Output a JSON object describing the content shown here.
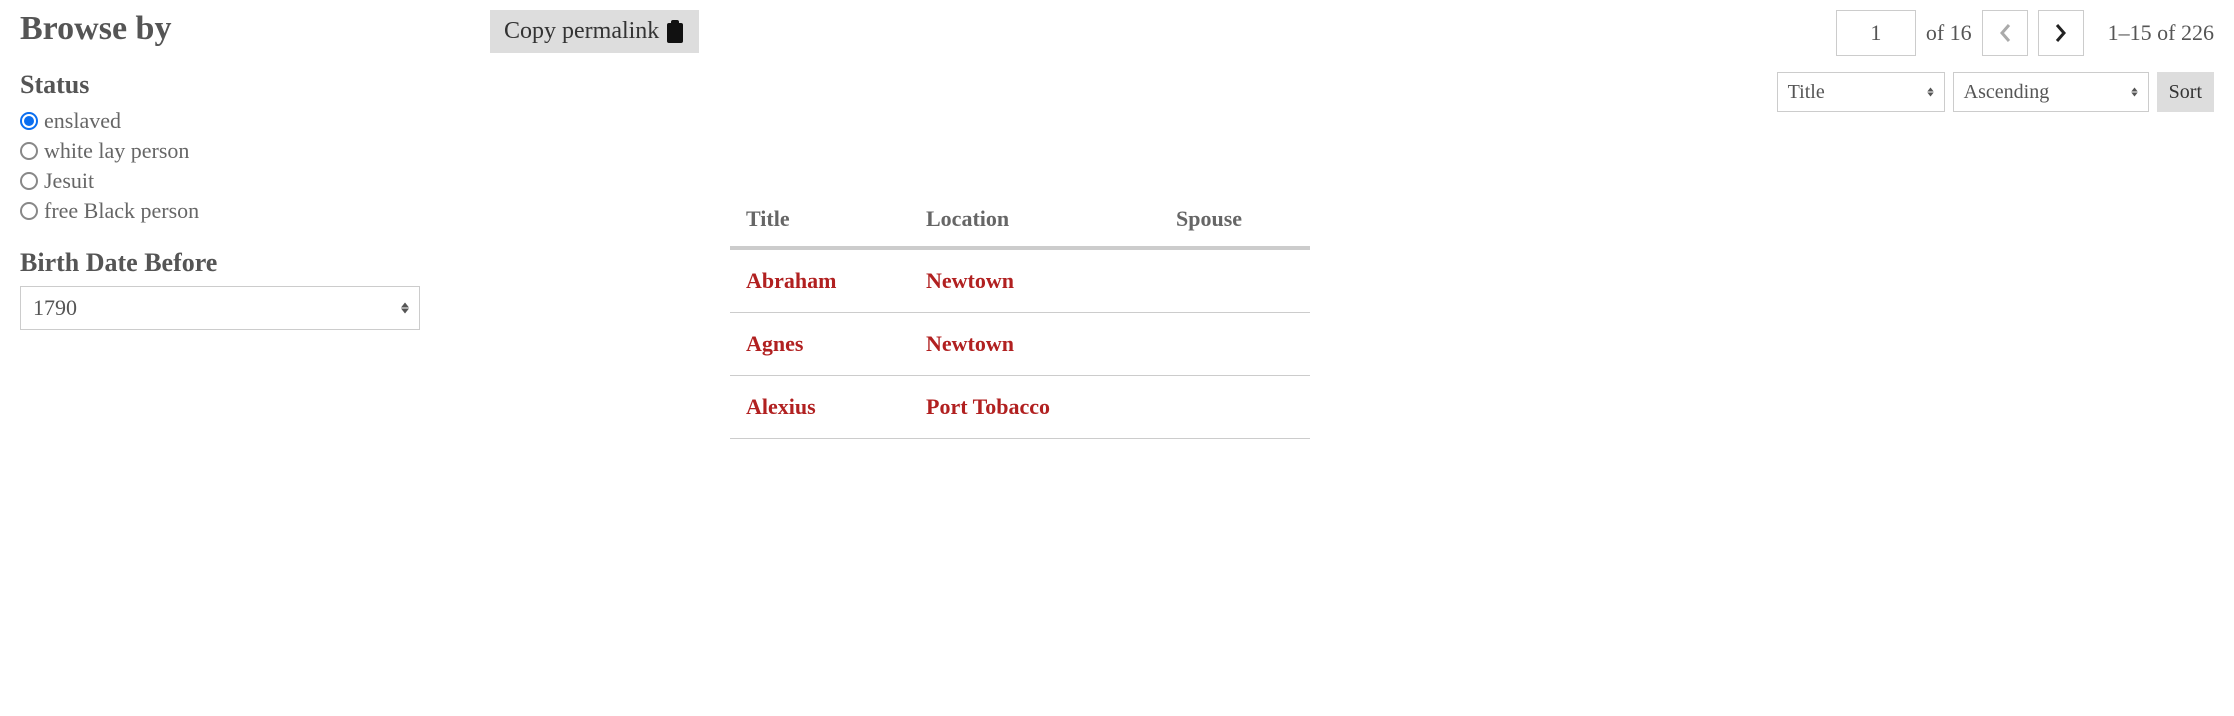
{
  "sidebar": {
    "heading": "Browse by",
    "status": {
      "heading": "Status",
      "options": [
        {
          "label": "enslaved",
          "selected": true
        },
        {
          "label": "white lay person",
          "selected": false
        },
        {
          "label": "Jesuit",
          "selected": false
        },
        {
          "label": "free Black person",
          "selected": false
        }
      ]
    },
    "birth_date": {
      "heading": "Birth Date Before",
      "value": "1790"
    }
  },
  "toolbar": {
    "copy_permalink": "Copy permalink"
  },
  "pagination": {
    "current_page": "1",
    "of_label": "of 16",
    "range": "1–15 of 226"
  },
  "sort": {
    "field": "Title",
    "direction": "Ascending",
    "button": "Sort"
  },
  "table": {
    "headers": {
      "title": "Title",
      "location": "Location",
      "spouse": "Spouse"
    },
    "rows": [
      {
        "title": "Abraham",
        "location": "Newtown",
        "spouse": ""
      },
      {
        "title": "Agnes",
        "location": "Newtown",
        "spouse": ""
      },
      {
        "title": "Alexius",
        "location": "Port Tobacco",
        "spouse": ""
      }
    ]
  }
}
